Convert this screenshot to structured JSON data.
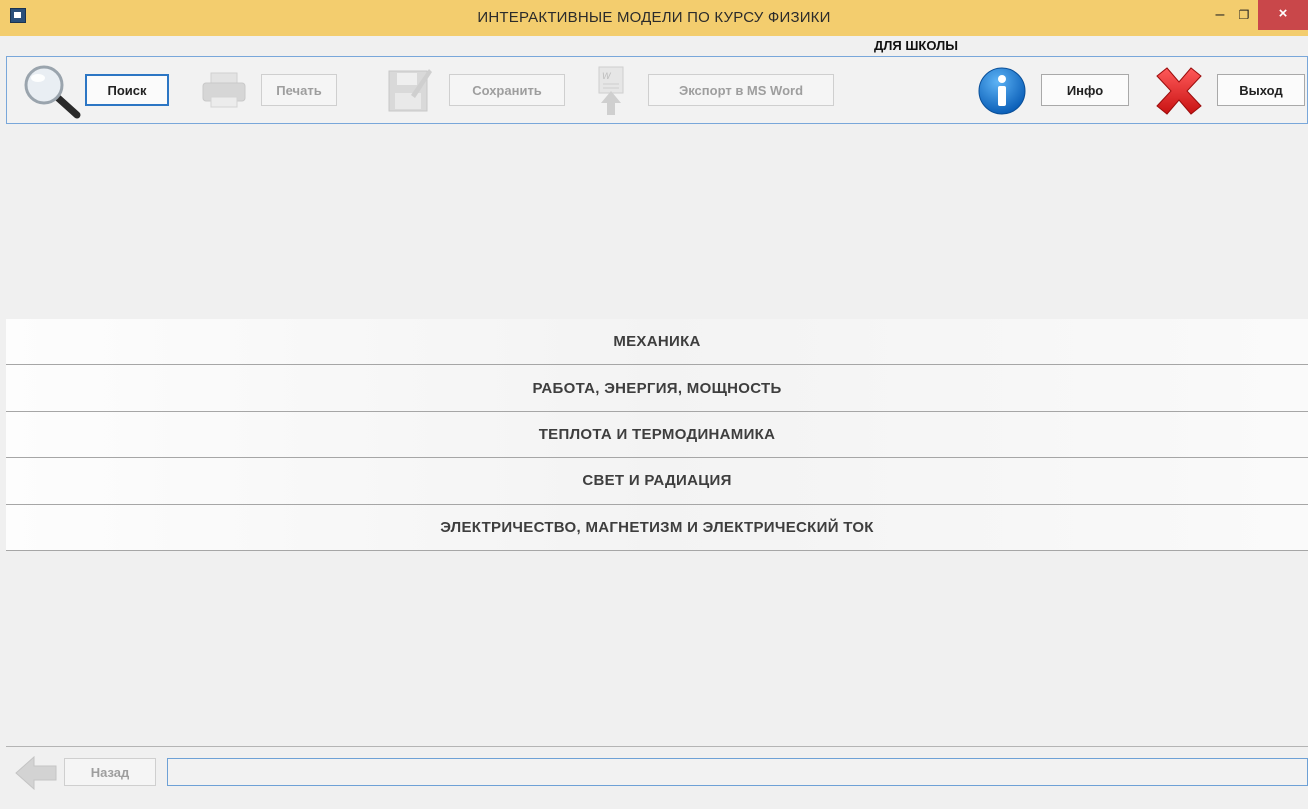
{
  "window": {
    "title": "ИНТЕРАКТИВНЫЕ МОДЕЛИ ПО КУРСУ ФИЗИКИ",
    "subtitle": "ДЛЯ ШКОЛЫ",
    "controls": {
      "minimize": "–",
      "restore": "❐",
      "close": "×"
    },
    "title_bar_color": "#f3cd6e",
    "close_color": "#c9474a"
  },
  "toolbar": {
    "search": {
      "label": "Поиск",
      "icon": "magnifier-icon",
      "enabled": true
    },
    "print": {
      "label": "Печать",
      "icon": "printer-icon",
      "enabled": false
    },
    "save": {
      "label": "Сохранить",
      "icon": "floppy-icon",
      "enabled": false
    },
    "export": {
      "label": "Экспорт в MS Word",
      "icon": "word-export-icon",
      "enabled": false
    },
    "info": {
      "label": "Инфо",
      "icon": "info-icon",
      "enabled": true
    },
    "exit": {
      "label": "Выход",
      "icon": "red-x-icon",
      "enabled": true
    }
  },
  "categories": [
    "МЕХАНИКА",
    "РАБОТА, ЭНЕРГИЯ, МОЩНОСТЬ",
    "ТЕПЛОТА И ТЕРМОДИНАМИКА",
    "СВЕТ И РАДИАЦИЯ",
    "ЭЛЕКТРИЧЕСТВО, МАГНЕТИЗМ И ЭЛЕКТРИЧЕСКИЙ ТОК"
  ],
  "footer": {
    "back_label": "Назад",
    "back_enabled": false,
    "path_value": ""
  }
}
